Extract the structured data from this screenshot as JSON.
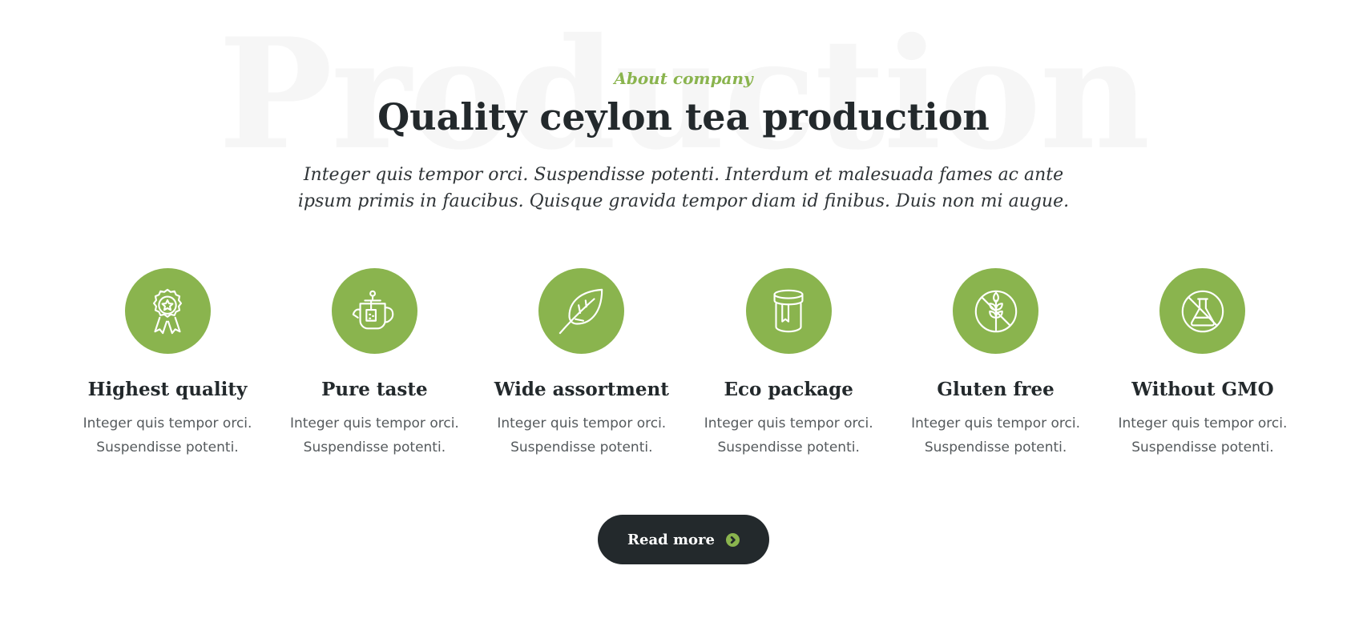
{
  "section": {
    "background_word": "Production",
    "eyebrow": "About company",
    "title": "Quality ceylon tea production",
    "lead": "Integer quis tempor orci. Suspendisse potenti. Interdum et malesuada fames ac ante ipsum primis in faucibus. Quisque gravida tempor diam id finibus. Duis non mi augue."
  },
  "features": [
    {
      "icon": "award-medal-icon",
      "title": "Highest quality",
      "text_line1": "Integer quis tempor orci.",
      "text_line2": "Suspendisse potenti."
    },
    {
      "icon": "teapot-icon",
      "title": "Pure taste",
      "text_line1": "Integer quis tempor orci.",
      "text_line2": "Suspendisse potenti."
    },
    {
      "icon": "leaf-icon",
      "title": "Wide assortment",
      "text_line1": "Integer quis tempor orci.",
      "text_line2": "Suspendisse potenti."
    },
    {
      "icon": "tea-jar-icon",
      "title": "Eco package",
      "text_line1": "Integer quis tempor orci.",
      "text_line2": "Suspendisse potenti."
    },
    {
      "icon": "no-gluten-icon",
      "title": "Gluten free",
      "text_line1": "Integer quis tempor orci.",
      "text_line2": "Suspendisse potenti."
    },
    {
      "icon": "no-gmo-flask-icon",
      "title": "Without GMO",
      "text_line1": "Integer quis tempor orci.",
      "text_line2": "Suspendisse potenti."
    }
  ],
  "button": {
    "label": "Read more",
    "icon": "chevron-right-circle-icon"
  },
  "colors": {
    "accent": "#8ab44e",
    "dark": "#23292c",
    "background_word": "#f6f6f6"
  }
}
